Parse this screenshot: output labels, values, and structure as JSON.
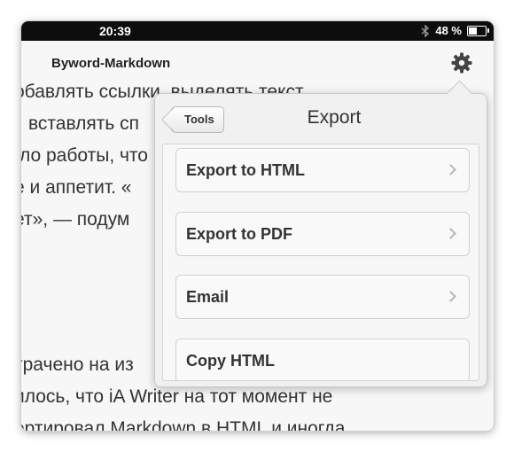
{
  "status_bar": {
    "time": "20:39",
    "battery": "48 %"
  },
  "nav": {
    "title": "Byword-Markdown"
  },
  "document": {
    "lines": [
      "обавлять ссылки, выделять текст",
      "вставлять сп",
      "ло работы, что",
      "е и аппетит. «",
      "ет», — подум",
      "",
      "",
      "трачено на из",
      "илось, что iA Writer на тот момент не",
      "ертировал Markdown в HTML и иногда"
    ]
  },
  "popover": {
    "back_label": "Tools",
    "title": "Export",
    "items": [
      {
        "label": "Export to HTML"
      },
      {
        "label": "Export to PDF"
      },
      {
        "label": "Email"
      },
      {
        "label": "Copy HTML"
      }
    ]
  }
}
